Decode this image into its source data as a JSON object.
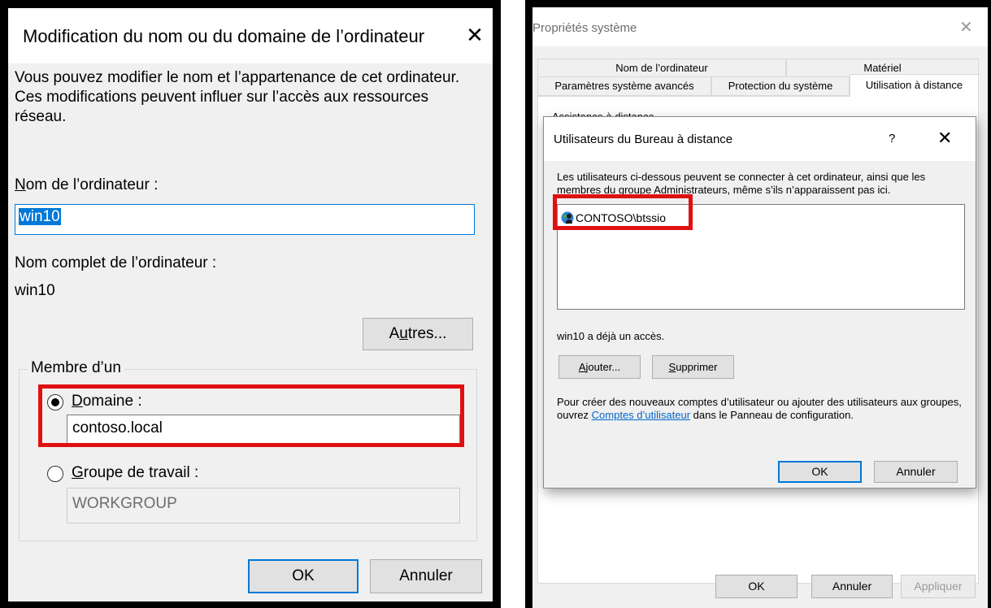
{
  "left_dialog": {
    "title": "Modification du nom ou du domaine de l’ordinateur",
    "close_glyph": "✕",
    "description": "Vous pouvez modifier le nom et l’appartenance de cet ordinateur. Ces modifications peuvent influer sur l’accès aux ressources réseau.",
    "computer_name_label_accel": "N",
    "computer_name_label_rest": "om de l’ordinateur :",
    "computer_name_value": "win10",
    "full_name_label": "Nom complet de l’ordinateur :",
    "full_name_value": "win10",
    "other_button_pre": "A",
    "other_button_accel": "u",
    "other_button_post": "tres...",
    "member_of_legend": "Membre d’un",
    "domain_label_accel": "D",
    "domain_label_rest": "omaine :",
    "domain_value": "contoso.local",
    "domain_selected": true,
    "workgroup_label_accel": "G",
    "workgroup_label_rest": "roupe de travail :",
    "workgroup_value": "WORKGROUP",
    "ok_label": "OK",
    "cancel_label": "Annuler",
    "highlight_color": "#e01010"
  },
  "system_properties": {
    "title": "Propriétés système",
    "close_glyph": "✕",
    "tabs_row1": [
      "Nom de l’ordinateur",
      "Matériel"
    ],
    "tabs_row2": [
      "Paramètres système avancés",
      "Protection du système",
      "Utilisation à distance"
    ],
    "active_tab": "Utilisation à distance",
    "section_legend": "Assistance à distance",
    "ok_label": "OK",
    "cancel_label": "Annuler",
    "apply_label": "Appliquer"
  },
  "remote_users_dialog": {
    "title": "Utilisateurs du Bureau à distance",
    "help_glyph": "?",
    "close_glyph": "✕",
    "description": "Les utilisateurs ci-dessous peuvent se connecter à cet ordinateur, ainsi que les membres du groupe Administrateurs, même s’ils n’apparaissent pas ici.",
    "users": [
      "CONTOSO\\btssio"
    ],
    "user_icon": "user-group-icon",
    "access_note": "win10 a déjà un accès.",
    "add_button_accel": "A",
    "add_button_rest": "jouter...",
    "remove_button_accel": "S",
    "remove_button_rest": "upprimer",
    "help_pre": "Pour créer des nouveaux comptes d’utilisateur ou ajouter des utilisateurs aux groupes, ouvrez",
    "help_link": "Comptes d’utilisateur",
    "help_post": "dans le Panneau de configuration.",
    "ok_label": "OK",
    "cancel_label": "Annuler",
    "accent_color": "#0078d7"
  }
}
